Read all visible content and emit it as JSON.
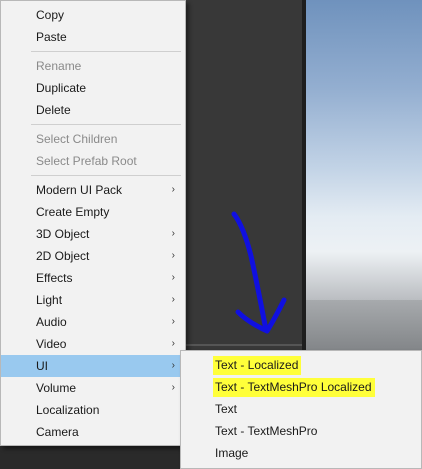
{
  "main_menu": {
    "items": [
      {
        "label": "Copy",
        "disabled": false,
        "submenu": false
      },
      {
        "label": "Paste",
        "disabled": false,
        "submenu": false
      },
      {
        "label": "Rename",
        "disabled": true,
        "submenu": false
      },
      {
        "label": "Duplicate",
        "disabled": false,
        "submenu": false
      },
      {
        "label": "Delete",
        "disabled": false,
        "submenu": false
      },
      {
        "label": "Select Children",
        "disabled": true,
        "submenu": false
      },
      {
        "label": "Select Prefab Root",
        "disabled": true,
        "submenu": false
      },
      {
        "label": "Modern UI Pack",
        "disabled": false,
        "submenu": true
      },
      {
        "label": "Create Empty",
        "disabled": false,
        "submenu": false
      },
      {
        "label": "3D Object",
        "disabled": false,
        "submenu": true
      },
      {
        "label": "2D Object",
        "disabled": false,
        "submenu": true
      },
      {
        "label": "Effects",
        "disabled": false,
        "submenu": true
      },
      {
        "label": "Light",
        "disabled": false,
        "submenu": true
      },
      {
        "label": "Audio",
        "disabled": false,
        "submenu": true
      },
      {
        "label": "Video",
        "disabled": false,
        "submenu": true
      },
      {
        "label": "UI",
        "disabled": false,
        "submenu": true,
        "selected": true
      },
      {
        "label": "Volume",
        "disabled": false,
        "submenu": true
      },
      {
        "label": "Localization",
        "disabled": false,
        "submenu": false
      },
      {
        "label": "Camera",
        "disabled": false,
        "submenu": false
      }
    ],
    "arrow_glyph": "›"
  },
  "ui_submenu": {
    "items": [
      {
        "label": "Text - Localized",
        "highlighted": true
      },
      {
        "label": "Text - TextMeshPro Localized",
        "highlighted": true
      },
      {
        "label": "Text",
        "highlighted": false
      },
      {
        "label": "Text - TextMeshPro",
        "highlighted": false
      },
      {
        "label": "Image",
        "highlighted": false
      }
    ]
  },
  "colors": {
    "menu_bg": "#f2f2f2",
    "selected_bg": "#99c9ef",
    "highlighter": "#ffff3a",
    "annotation_arrow": "#1010e0"
  },
  "annotation": {
    "type": "hand-drawn arrow",
    "icon": "arrow-down-icon"
  }
}
